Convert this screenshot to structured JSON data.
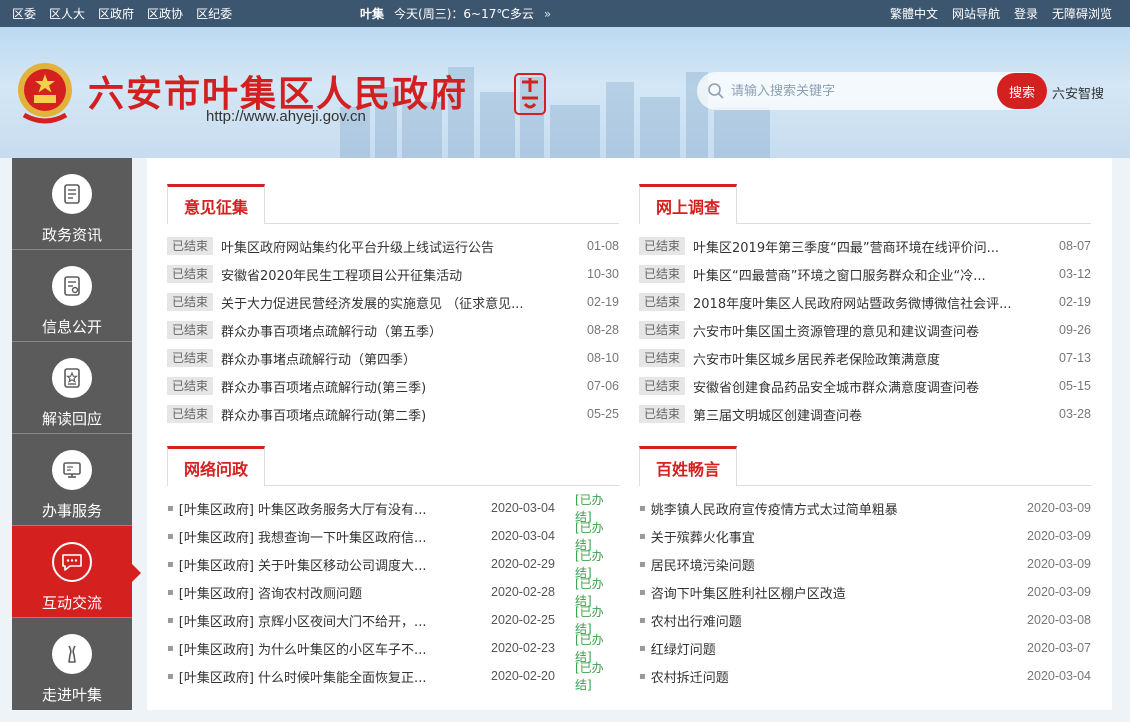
{
  "topbar": {
    "left_links": [
      "区委",
      "区人大",
      "区政府",
      "区政协",
      "区纪委"
    ],
    "city": "叶集",
    "weather": "今天(周三)：6~17℃多云",
    "right_links": [
      "繁體中文",
      "网站导航",
      "登录",
      "无障碍浏览"
    ]
  },
  "header": {
    "title": "六安市叶集区人民政府",
    "url": "http://www.ahyeji.gov.cn",
    "search_placeholder": "请输入搜索关键字",
    "search_button": "搜索",
    "smart_search": "六安智搜"
  },
  "sidebar": {
    "items": [
      {
        "label": "政务资讯",
        "icon": "document-icon"
      },
      {
        "label": "信息公开",
        "icon": "info-list-icon"
      },
      {
        "label": "解读回应",
        "icon": "interpret-icon"
      },
      {
        "label": "办事服务",
        "icon": "service-monitor-icon"
      },
      {
        "label": "互动交流",
        "icon": "chat-icon"
      },
      {
        "label": "走进叶集",
        "icon": "landmark-icon"
      }
    ],
    "active_index": 4
  },
  "sections": {
    "opinions": {
      "title": "意见征集",
      "rows": [
        {
          "tag": "已结束",
          "title": "叶集区政府网站集约化平台升级上线试运行公告",
          "date": "01-08"
        },
        {
          "tag": "已结束",
          "title": "安徽省2020年民生工程项目公开征集活动",
          "date": "10-30"
        },
        {
          "tag": "已结束",
          "title": "关于大力促进民营经济发展的实施意见 （征求意见...",
          "date": "02-19"
        },
        {
          "tag": "已结束",
          "title": "群众办事百项堵点疏解行动（第五季）",
          "date": "08-28"
        },
        {
          "tag": "已结束",
          "title": "群众办事堵点疏解行动（第四季）",
          "date": "08-10"
        },
        {
          "tag": "已结束",
          "title": "群众办事百项堵点疏解行动(第三季)",
          "date": "07-06"
        },
        {
          "tag": "已结束",
          "title": "群众办事百项堵点疏解行动(第二季)",
          "date": "05-25"
        }
      ]
    },
    "survey": {
      "title": "网上调查",
      "rows": [
        {
          "tag": "已结束",
          "title": "叶集区2019年第三季度“四最”营商环境在线评价问...",
          "date": "08-07"
        },
        {
          "tag": "已结束",
          "title": "叶集区“四最营商”环境之窗口服务群众和企业“冷...",
          "date": "03-12"
        },
        {
          "tag": "已结束",
          "title": "2018年度叶集区人民政府网站暨政务微博微信社会评...",
          "date": "02-19"
        },
        {
          "tag": "已结束",
          "title": "六安市叶集区国土资源管理的意见和建议调查问卷",
          "date": "09-26"
        },
        {
          "tag": "已结束",
          "title": "六安市叶集区城乡居民养老保险政策满意度",
          "date": "07-13"
        },
        {
          "tag": "已结束",
          "title": "安徽省创建食品药品安全城市群众满意度调查问卷",
          "date": "05-15"
        },
        {
          "tag": "已结束",
          "title": "第三届文明城区创建调查问卷",
          "date": "03-28"
        }
      ]
    },
    "inquiry": {
      "title": "网络问政",
      "rows": [
        {
          "title": "[叶集区政府] 叶集区政务服务大厅有没有...",
          "date": "2020-03-04",
          "status": "[已办结]"
        },
        {
          "title": "[叶集区政府] 我想查询一下叶集区政府信...",
          "date": "2020-03-04",
          "status": "[已办结]"
        },
        {
          "title": "[叶集区政府] 关于叶集区移动公司调度大...",
          "date": "2020-02-29",
          "status": "[已办结]"
        },
        {
          "title": "[叶集区政府] 咨询农村改厕问题",
          "date": "2020-02-28",
          "status": "[已办结]"
        },
        {
          "title": "[叶集区政府] 京辉小区夜间大门不给开，...",
          "date": "2020-02-25",
          "status": "[已办结]"
        },
        {
          "title": "[叶集区政府] 为什么叶集区的小区车子不...",
          "date": "2020-02-23",
          "status": "[已办结]"
        },
        {
          "title": "[叶集区政府] 什么时候叶集能全面恢复正...",
          "date": "2020-02-20",
          "status": "[已办结]"
        }
      ]
    },
    "voices": {
      "title": "百姓畅言",
      "rows": [
        {
          "title": "姚李镇人民政府宣传疫情方式太过简单粗暴",
          "date": "2020-03-09"
        },
        {
          "title": "关于殡葬火化事宜",
          "date": "2020-03-09"
        },
        {
          "title": "居民环境污染问题",
          "date": "2020-03-09"
        },
        {
          "title": "咨询下叶集区胜利社区棚户区改造",
          "date": "2020-03-09"
        },
        {
          "title": "农村出行难问题",
          "date": "2020-03-08"
        },
        {
          "title": "红绿灯问题",
          "date": "2020-03-07"
        },
        {
          "title": "农村拆迁问题",
          "date": "2020-03-04"
        }
      ]
    }
  },
  "colors": {
    "accent": "#d52020",
    "topbar": "#3d5670",
    "sidebar": "#5b5b5b",
    "done": "#3aa14a"
  }
}
